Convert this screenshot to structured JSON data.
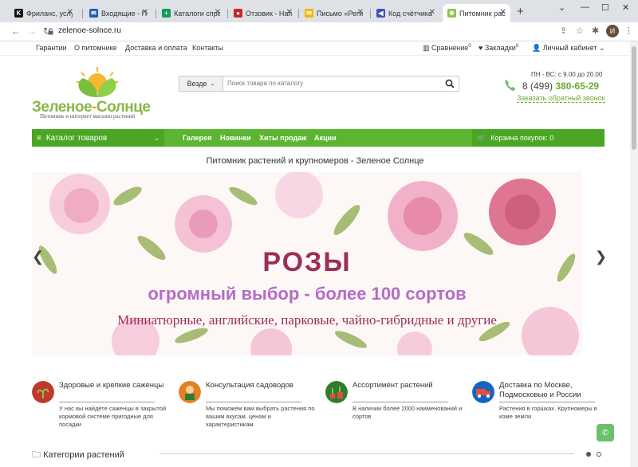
{
  "browser": {
    "tabs": [
      {
        "title": "Фриланс, услуги",
        "fav": "K",
        "color": "#111111"
      },
      {
        "title": "Входящие - Почта",
        "fav": "✉",
        "color": "#1a5fb4"
      },
      {
        "title": "Каталоги справок",
        "fav": "+",
        "color": "#0f9d58"
      },
      {
        "title": "Отзовик - Напиши",
        "fav": "●",
        "color": "#c62828"
      },
      {
        "title": "Письмо «Регистр",
        "fav": "✉",
        "color": "#f4b400"
      },
      {
        "title": "Код счётчика",
        "fav": "◀",
        "color": "#3f51b5"
      },
      {
        "title": "Питомник расте",
        "fav": "❀",
        "color": "#8bc34a"
      }
    ],
    "url": "zelenoe-solnce.ru",
    "avatar_letter": "И"
  },
  "toplinks": {
    "left": [
      "Гарантии",
      "О питомнике",
      "Доставка и оплата",
      "Контакты"
    ],
    "compare_label": "Сравнение",
    "compare_count": "0",
    "bookmarks_label": "Закладки",
    "bookmarks_count": "0",
    "account_label": "Личный кабинет"
  },
  "logo": {
    "title_a": "Зеленое",
    "title_b": "-",
    "title_c": "Солнце",
    "subtitle": "Питомник и интернет магазин растений"
  },
  "search": {
    "scope": "Везде",
    "placeholder": "Поиск товара по каталогу"
  },
  "contact": {
    "hours": "ПН - ВС: с 9.00 до 20.00",
    "phone_prefix": "8 (499)",
    "phone_number": "380-65-29",
    "callback": "Заказать обратный звонок"
  },
  "nav": {
    "catalog": "Каталог товаров",
    "links": [
      "Галерея",
      "Новинки",
      "Хиты продаж",
      "Акции"
    ],
    "cart": "Корзина покупок: 0"
  },
  "page_title": "Питомник растений и крупномеров - Зеленое Солнце",
  "banner": {
    "title": "РОЗЫ",
    "subtitle": "огромный выбор - более 100 сортов",
    "subtitle2": "Миниатюрные, английские, парковые, чайно-гибридные и другие"
  },
  "features": [
    {
      "title": "Здоровые и крепкие саженцы",
      "desc": "У нас вы найдете саженцы в закрытой кормовой системе пригодные для посадки",
      "color": "#c0392b"
    },
    {
      "title": "Консультация садоводов",
      "desc": "Мы поможем вам выбрать растения по вашим вкусам, ценам и характеристикам.",
      "color": "#e67e22"
    },
    {
      "title": "Ассортимент растений",
      "desc": "В наличии более 2000 наименований и сортов",
      "color": "#2e7d32"
    },
    {
      "title": "Доставка по Москве, Подмосковью и России",
      "desc": "Растения в горшках. Крупномеры в коме земли",
      "color": "#1565c0"
    }
  ],
  "categories_title": "Категории растений"
}
